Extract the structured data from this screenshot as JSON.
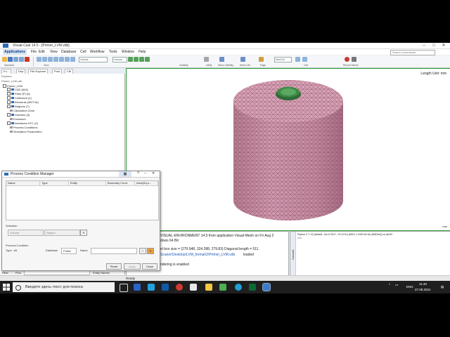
{
  "window": {
    "title": "Visual-Cast 14.5 - [Primer_LVM.vdb]"
  },
  "menu": {
    "app": "Applications",
    "items": [
      "File",
      "Edit",
      "View",
      "Database",
      "Cell",
      "Workflow",
      "Tools",
      "Window",
      "Help"
    ],
    "search_placeholder": "Search commands"
  },
  "ribbon": {
    "groups": [
      "Standard",
      "View",
      "Visibility",
      "Utility",
      "Mesh Visibility",
      "Mesh Util.",
      "Page",
      "Cell",
      "Record Movie"
    ],
    "combo1": "Volume",
    "combo2": "Volume",
    "combo3": "MaxCell"
  },
  "left_tabs": [
    "Fo...",
    "Dep",
    "File Explorer",
    "Post",
    "Ctb"
  ],
  "explorer": {
    "header": "Explorer",
    "root": "Primer_LVM.vdb",
    "nodes": [
      "Primer_LVM",
      "CAD (644)",
      "Parts (P) (6)",
      "Collectors (2)",
      "Elements (987716)",
      "Regions (7)",
      "Calculation Zone",
      "Volumes (3)",
      "Enclosure",
      "Interfaces HTC (2)",
      "Process Conditions",
      "Simulation Parameters"
    ]
  },
  "viewport": {
    "length_unit": "Length Unit: mm",
    "corner": "mm"
  },
  "dialog": {
    "title": "Process Condition Manager",
    "columns": [
      "Name",
      "Type",
      "Entity",
      "Boundary Cond.",
      "Area(Sq.u..."
    ],
    "selection_label": "Selection",
    "sel_combo1": "Volume",
    "sel_combo2": "Region",
    "pc_label": "Process Condition",
    "type_label": "Type : All",
    "database_label": "Database",
    "database_value": "Public",
    "name_label": "Name",
    "buttons": {
      "reset": "Reset",
      "apply": "Apply",
      "close": "Close"
    }
  },
  "filter": {
    "label": "Filter",
    "find": "Find",
    "entity": "Entity Names"
  },
  "console": {
    "lines": [
      "VISUAL-ENVIRONMENT 14.5 from application Visual-Mesh on Fri Aug 2",
      "dows 64 Bit",
      "el box size          = (279.948,  324.288,  279.83)  Diagonal length = 511.",
      "Scaner\\Desktop\\LVM_format\\2\\Primer_LVM.vdb",
      " loaded",
      "ndering is enabled"
    ],
    "python_lines": [
      "Python 2.7.13 (default, Jun  6 2017, 13:12:01) [MSC v.1900 64 bit (AMD64)] on win32",
      ">>>"
    ],
    "tab": "Console"
  },
  "status": {
    "ready": "Ready"
  },
  "taskbar": {
    "search": "Введите здесь текст для поиска",
    "lang": "ENG",
    "time": "11:49",
    "date": "27.08.2021"
  },
  "colors": {
    "mesh_body": "#c98ba2",
    "mesh_top": "#d9a2b6",
    "cap_green": "#3e8a45",
    "viewport_border": "#2d9a3a"
  }
}
